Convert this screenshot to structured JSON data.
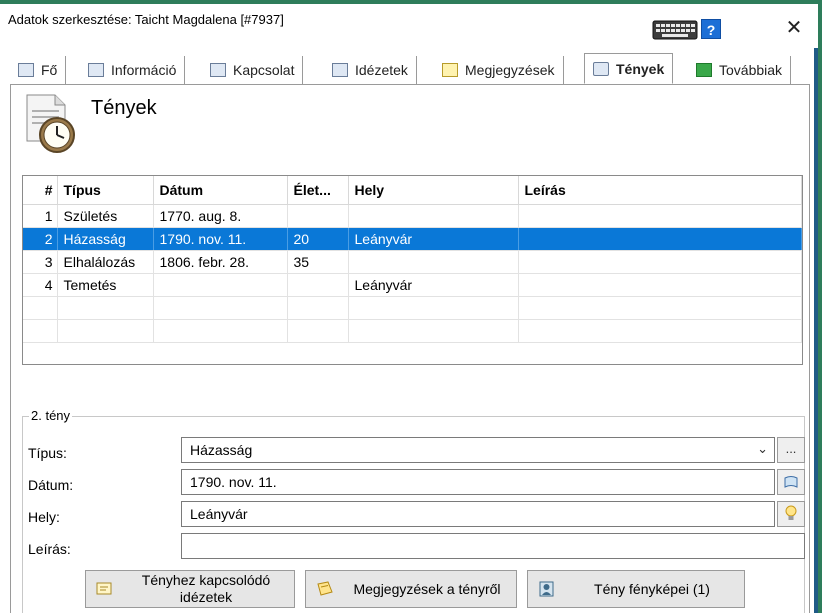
{
  "window": {
    "title": "Adatok szerkesztése: Taicht Magdalena [#7937]",
    "close_label": "✕",
    "help_label": "?"
  },
  "tabs": [
    {
      "label": "Fő",
      "icon": "id-card-icon"
    },
    {
      "label": "Információ",
      "icon": "info-list-icon"
    },
    {
      "label": "Kapcsolat",
      "icon": "home-icon"
    },
    {
      "label": "Idézetek",
      "icon": "quote-icon"
    },
    {
      "label": "Megjegyzések",
      "icon": "note-icon"
    },
    {
      "label": "Tények",
      "icon": "clock-icon",
      "active": true
    },
    {
      "label": "Továbbiak",
      "icon": "plus-icon"
    }
  ],
  "section": {
    "title": "Tények",
    "icon": "document-clock-icon"
  },
  "grid": {
    "headers": [
      "#",
      "Típus",
      "Dátum",
      "Élet...",
      "Hely",
      "Leírás"
    ],
    "rows": [
      {
        "num": "1",
        "type": "Születés",
        "date": "1770. aug. 8.",
        "age": "",
        "place": "",
        "desc": ""
      },
      {
        "num": "2",
        "type": "Házasság",
        "date": "1790. nov. 11.",
        "age": "20",
        "place": "Leányvár",
        "desc": ""
      },
      {
        "num": "3",
        "type": "Elhalálozás",
        "date": "1806. febr. 28.",
        "age": "35",
        "place": "",
        "desc": ""
      },
      {
        "num": "4",
        "type": "Temetés",
        "date": "",
        "age": "",
        "place": "Leányvár",
        "desc": ""
      }
    ],
    "selected_row": 2
  },
  "detail": {
    "legend": "2. tény",
    "type_label": "Típus:",
    "type_value": "Házasság",
    "type_more": "...",
    "date_label": "Dátum:",
    "date_value": "1790. nov. 11.",
    "place_label": "Hely:",
    "place_value": "Leányvár",
    "desc_label": "Leírás:",
    "desc_value": ""
  },
  "buttons": {
    "quotes": "Tényhez kapcsolódó idézetek",
    "notes": "Megjegyzések a tényről",
    "photos": "Tény fényképei (1)"
  },
  "colors": {
    "selection": "#0a78d7",
    "help": "#1d6fd6",
    "desktop": "#2e7d5b"
  }
}
